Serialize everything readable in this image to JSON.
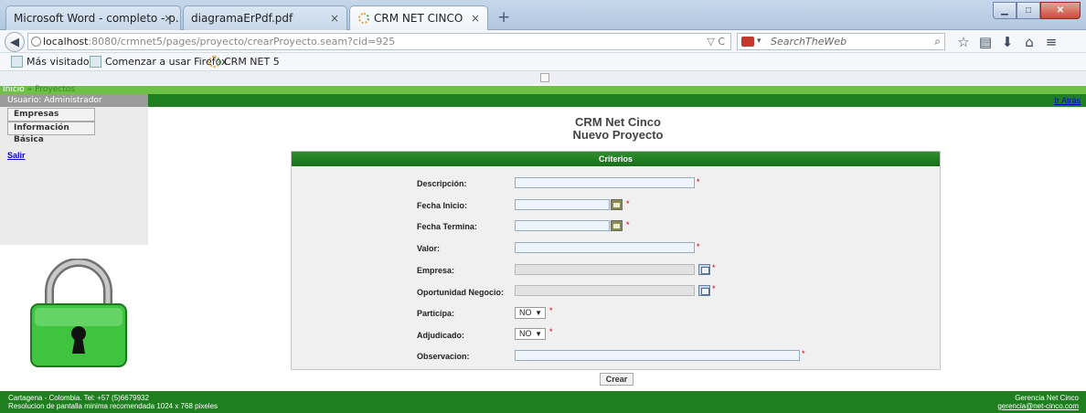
{
  "browser": {
    "tabs": [
      {
        "title": "Microsoft Word - completo - p...",
        "close": "×"
      },
      {
        "title": "diagramaErPdf.pdf",
        "close": "×"
      },
      {
        "title": "CRM NET CINCO",
        "close": "×"
      }
    ],
    "new_tab": "+",
    "window_buttons": [
      "▁",
      "□",
      "✕"
    ],
    "url_host": "localhost",
    "url_rest": ":8080/crmnet5/pages/proyecto/crearProyecto.seam?cid=925",
    "url_tools": "▽ C",
    "search_placeholder": "SearchTheWeb",
    "bookmarks": [
      "Más visitados",
      "Comenzar a usar Firefox",
      "CRM NET 5"
    ]
  },
  "app": {
    "breadcrumb_home": "Inicio",
    "breadcrumb_sep": " » ",
    "breadcrumb_current": "Proyectos",
    "user_label": "Usuario: Administrador",
    "back_link": "Ir Atrás",
    "sidebar": {
      "buttons": [
        "Empresas",
        "Información Básica"
      ],
      "logout": "Salir"
    },
    "title_line1": "CRM Net Cinco",
    "title_line2": "Nuevo Proyecto",
    "panel_title": "Criterios",
    "fields": {
      "descripcion": {
        "label": "Descripción:",
        "value": ""
      },
      "fecha_inicio": {
        "label": "Fecha Inicio:",
        "value": ""
      },
      "fecha_termina": {
        "label": "Fecha Termina:",
        "value": ""
      },
      "valor": {
        "label": "Valor:",
        "value": ""
      },
      "empresa": {
        "label": "Empresa:",
        "value": ""
      },
      "oportunidad": {
        "label": "Oportunidad Negocio:",
        "value": ""
      },
      "participa": {
        "label": "Participa:",
        "value": "NO"
      },
      "adjudicado": {
        "label": "Adjudicado:",
        "value": "NO"
      },
      "observacion": {
        "label": "Observacion:",
        "value": ""
      }
    },
    "required_mark": "*",
    "submit_label": "Crear",
    "footer": {
      "left_line1": "Cartagena - Colombia. Tel: +57 (5)6679932",
      "left_line2": "Resolucion de pantalla minima recomendada 1024 x 768 pixeles",
      "right_line1": "Gerencia Net Cinco",
      "right_email": "gerencia@net-cinco.com"
    }
  },
  "colors": {
    "header_green": "#1f7e1f",
    "breadcrumb_green": "#6dc246",
    "required_red": "#cc0000"
  }
}
